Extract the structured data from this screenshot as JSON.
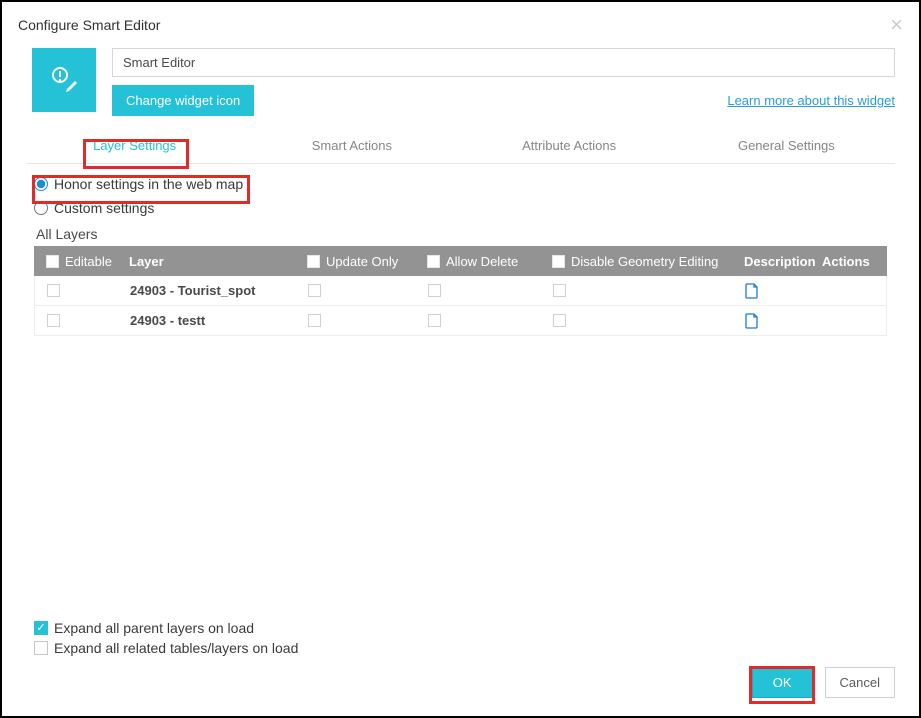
{
  "dialog": {
    "title": "Configure Smart Editor"
  },
  "widget": {
    "name": "Smart Editor",
    "change_icon": "Change widget icon",
    "learn_more": "Learn more about this widget"
  },
  "tabs": {
    "layer": "Layer Settings",
    "smart": "Smart Actions",
    "attr": "Attribute Actions",
    "general": "General Settings"
  },
  "radios": {
    "honor": "Honor settings in the web map",
    "custom": "Custom settings"
  },
  "table": {
    "title": "All Layers",
    "headers": {
      "editable": "Editable",
      "layer": "Layer",
      "update": "Update Only",
      "allow": "Allow Delete",
      "geom": "Disable Geometry Editing",
      "desc": "Description",
      "actions": "Actions"
    },
    "rows": [
      {
        "layer": "24903 - Tourist_spot"
      },
      {
        "layer": "24903 - testt"
      }
    ]
  },
  "bottom": {
    "expand_parent": "Expand all parent layers on load",
    "expand_related": "Expand all related tables/layers on load"
  },
  "footer": {
    "ok": "OK",
    "cancel": "Cancel"
  }
}
